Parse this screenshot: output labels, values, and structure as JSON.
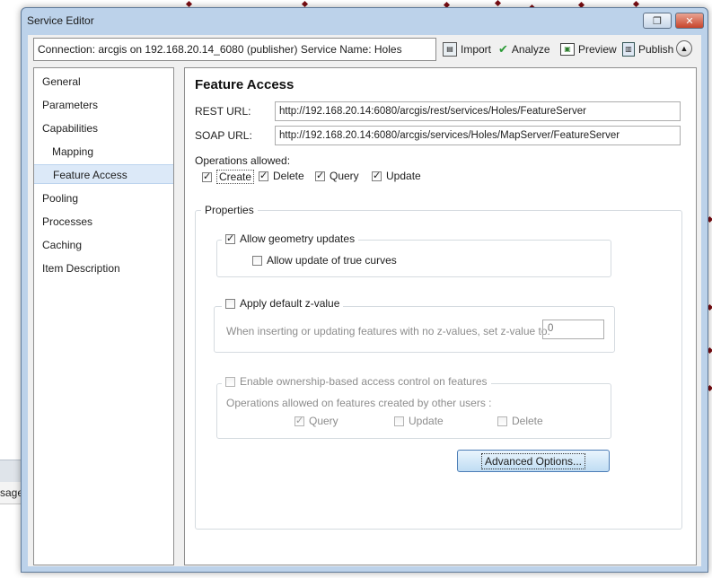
{
  "window": {
    "title": "Service Editor"
  },
  "background": {
    "partial_text": "sage"
  },
  "toolbar": {
    "connection": "Connection: arcgis on 192.168.20.14_6080 (publisher)   Service Name: Holes",
    "import": "Import",
    "analyze": "Analyze",
    "preview": "Preview",
    "publish": "Publish"
  },
  "nav": {
    "items": [
      "General",
      "Parameters",
      "Capabilities",
      "Mapping",
      "Feature Access",
      "Pooling",
      "Processes",
      "Caching",
      "Item Description"
    ],
    "selected": "Feature Access"
  },
  "panel": {
    "heading": "Feature Access",
    "rest_label": "REST URL:",
    "rest_url": "http://192.168.20.14:6080/arcgis/rest/services/Holes/FeatureServer",
    "soap_label": "SOAP URL:",
    "soap_url": "http://192.168.20.14:6080/arcgis/services/Holes/MapServer/FeatureServer",
    "ops_label": "Operations allowed:",
    "ops": {
      "create": {
        "label": "Create",
        "checked": true
      },
      "delete": {
        "label": "Delete",
        "checked": true
      },
      "query": {
        "label": "Query",
        "checked": true
      },
      "update": {
        "label": "Update",
        "checked": true
      }
    },
    "properties_label": "Properties",
    "allow_geometry": {
      "label": "Allow geometry updates",
      "checked": true
    },
    "allow_curves": {
      "label": "Allow update of true curves",
      "checked": false
    },
    "apply_z": {
      "label": "Apply default z-value",
      "checked": false
    },
    "z_desc": "When inserting or updating features with no z-values, set z-value to:",
    "z_value": "0",
    "ownership": {
      "label": "Enable ownership-based access control on features",
      "checked": false
    },
    "others_label": "Operations allowed on features created by other users :",
    "others_ops": {
      "query": {
        "label": "Query",
        "checked": true
      },
      "update": {
        "label": "Update",
        "checked": false
      },
      "delete": {
        "label": "Delete",
        "checked": false
      }
    },
    "advanced_button": "Advanced Options..."
  }
}
